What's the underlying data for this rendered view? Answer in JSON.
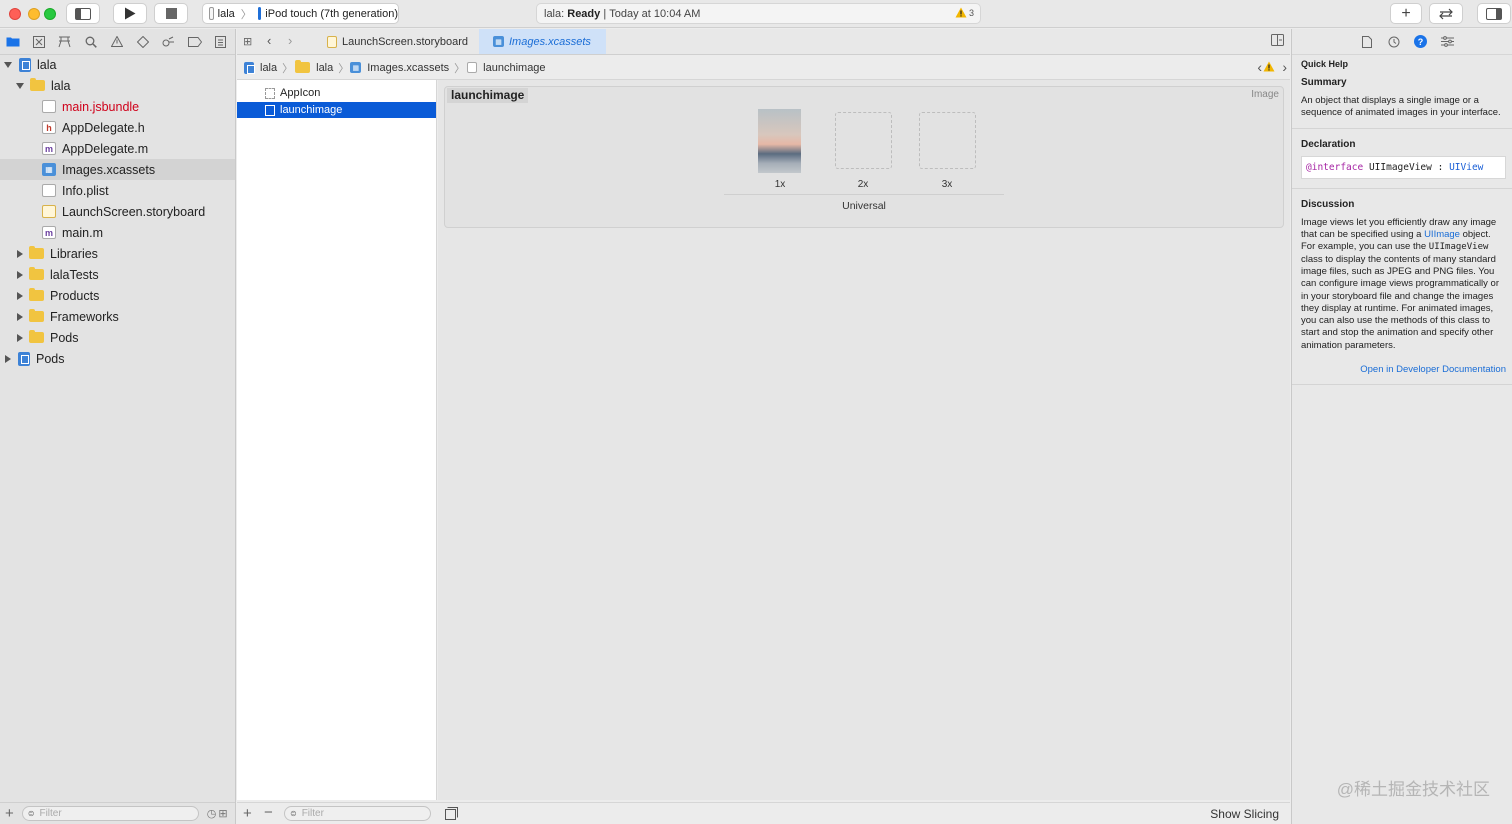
{
  "toolbar": {
    "scheme_project": "lala",
    "scheme_device": "iPod touch (7th generation)",
    "activity_project": "lala:",
    "activity_status": "Ready",
    "activity_separator": "|",
    "activity_time": "Today at 10:04 AM",
    "warning_count": "3",
    "colors": {
      "close": "#fe5f57",
      "minimize": "#febc2e",
      "zoom": "#28c840"
    }
  },
  "navigator": {
    "tree": [
      {
        "label": "lala",
        "icon": "project-icon",
        "disclosure": "open"
      },
      {
        "label": "lala",
        "icon": "folder-icon",
        "disclosure": "open"
      },
      {
        "label": "main.jsbundle",
        "icon": "jsbundle-icon",
        "color": "#d0021b"
      },
      {
        "label": "AppDelegate.h",
        "icon": "header-file-icon",
        "badge": "h"
      },
      {
        "label": "AppDelegate.m",
        "icon": "objc-file-icon",
        "badge": "m"
      },
      {
        "label": "Images.xcassets",
        "icon": "asset-catalog-icon",
        "selected": true
      },
      {
        "label": "Info.plist",
        "icon": "plist-icon"
      },
      {
        "label": "LaunchScreen.storyboard",
        "icon": "storyboard-icon"
      },
      {
        "label": "main.m",
        "icon": "objc-file-icon",
        "badge": "m"
      },
      {
        "label": "Libraries",
        "icon": "folder-icon",
        "disclosure": "closed"
      },
      {
        "label": "lalaTests",
        "icon": "folder-icon",
        "disclosure": "closed"
      },
      {
        "label": "Products",
        "icon": "folder-icon",
        "disclosure": "closed"
      },
      {
        "label": "Frameworks",
        "icon": "folder-icon",
        "disclosure": "closed"
      },
      {
        "label": "Pods",
        "icon": "folder-icon",
        "disclosure": "closed"
      },
      {
        "label": "Pods",
        "icon": "project-icon",
        "disclosure": "closed"
      }
    ],
    "filter_placeholder": "Filter"
  },
  "editor": {
    "tabs": [
      {
        "label": "LaunchScreen.storyboard",
        "active": false
      },
      {
        "label": "Images.xcassets",
        "active": true
      }
    ],
    "breadcrumb": [
      "lala",
      "lala",
      "Images.xcassets",
      "launchimage"
    ],
    "assets": [
      {
        "label": "AppIcon",
        "selected": false
      },
      {
        "label": "launchimage",
        "selected": true
      }
    ],
    "asset_filter_placeholder": "Filter",
    "image_set": {
      "name": "launchimage",
      "kind": "Image",
      "slots": [
        "1x",
        "2x",
        "3x"
      ],
      "group": "Universal"
    },
    "show_slicing": "Show Slicing"
  },
  "inspector": {
    "quick_help_title": "Quick Help",
    "summary_heading": "Summary",
    "summary_text": "An object that displays a single image or a sequence of animated images in your interface.",
    "declaration_heading": "Declaration",
    "decl_keyword": "@interface",
    "decl_class": "UIImageView",
    "decl_colon": ":",
    "decl_super": "UIView",
    "discussion_heading": "Discussion",
    "discussion_1": "Image views let you efficiently draw any image that can be specified using a",
    "discussion_link": "UIImage",
    "discussion_2": "object. For example, you can use the",
    "discussion_code": "UIImageView",
    "discussion_3": "class to display the contents of many standard image files, such as JPEG and PNG files. You can configure image views programmatically or in your storyboard file and change the images they display at runtime. For animated images, you can also use the methods of this class to start and stop the animation and specify other animation parameters.",
    "open_docs": "Open in Developer Documentation"
  },
  "watermark": "@稀土掘金技术社区"
}
